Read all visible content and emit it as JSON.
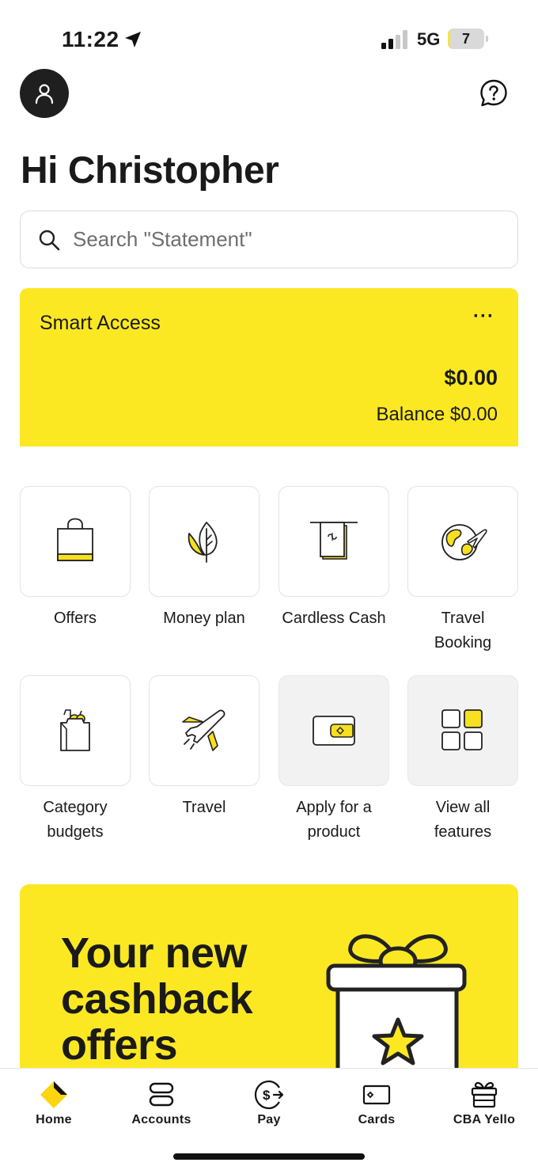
{
  "status_bar": {
    "time": "11:22",
    "network": "5G",
    "battery": "7",
    "battery_level": 0.07
  },
  "header": {
    "greeting": "Hi Christopher"
  },
  "search": {
    "placeholder": "Search \"Statement\""
  },
  "account": {
    "name": "Smart Access",
    "more": "···",
    "amount": "$0.00",
    "balance": "Balance $0.00"
  },
  "features": [
    {
      "label": "Offers",
      "icon": "shopping-bag-icon"
    },
    {
      "label": "Money plan",
      "icon": "leaf-icon"
    },
    {
      "label": "Cardless Cash",
      "icon": "cash-withdrawal-icon"
    },
    {
      "label": "Travel Booking",
      "icon": "globe-plane-icon"
    },
    {
      "label": "Category budgets",
      "icon": "grocery-bag-icon"
    },
    {
      "label": "Travel",
      "icon": "airplane-icon"
    },
    {
      "label": "Apply for a product",
      "icon": "wallet-icon"
    },
    {
      "label": "View all features",
      "icon": "grid-icon"
    }
  ],
  "banner": {
    "text": "Your new cashback offers"
  },
  "tabs": [
    {
      "label": "Home",
      "icon": "commbank-diamond-icon"
    },
    {
      "label": "Accounts",
      "icon": "accounts-icon"
    },
    {
      "label": "Pay",
      "icon": "pay-icon"
    },
    {
      "label": "Cards",
      "icon": "card-icon"
    },
    {
      "label": "CBA Yello",
      "icon": "gift-icon"
    }
  ],
  "colors": {
    "brand_yellow": "#fbe823",
    "dark": "#1a1a1a"
  }
}
